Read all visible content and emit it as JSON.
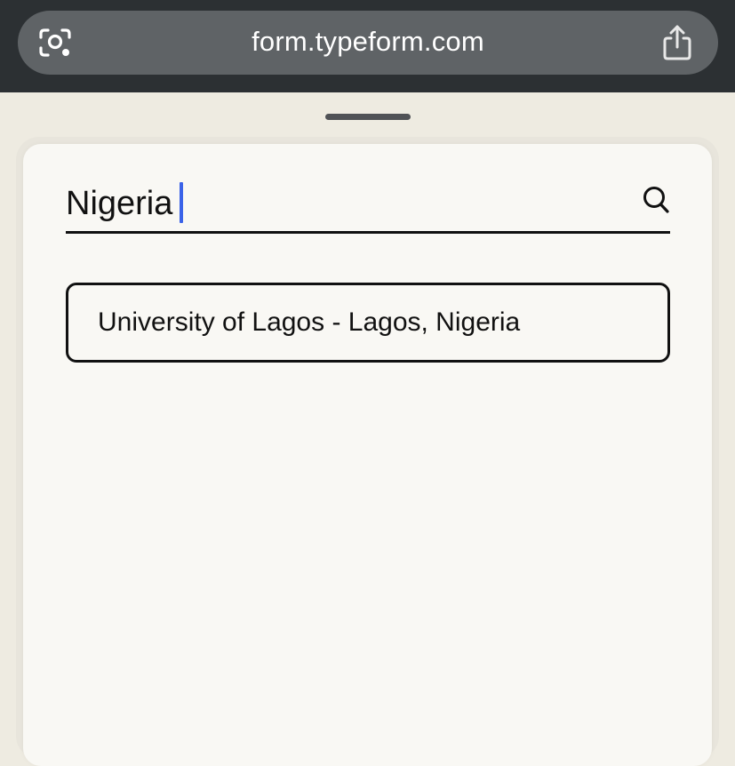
{
  "browser": {
    "url": "form.typeform.com",
    "lens_icon": "lens-icon",
    "share_icon": "share-icon"
  },
  "search": {
    "value": "Nigeria",
    "icon": "search-icon"
  },
  "results": [
    {
      "label": "University of Lagos - Lagos, Nigeria"
    }
  ],
  "colors": {
    "topbar": "#2c3033",
    "url_pill": "#5f6366",
    "sheet_background": "#f9f8f4",
    "page_background": "#eeebe1",
    "caret": "#3b63e8",
    "text": "#111111"
  }
}
